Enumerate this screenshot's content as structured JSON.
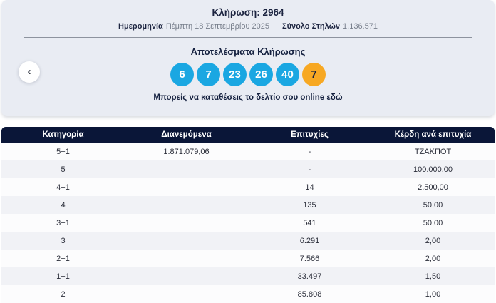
{
  "colors": {
    "navy": "#0a1638",
    "ball_blue": "#1aa7e2",
    "ball_orange": "#f7a823",
    "card_bg": "#e9ecf3",
    "row_alt_bg": "#f1f2f6"
  },
  "header": {
    "draw_label": "Κλήρωση: 2964",
    "date_label": "Ημερομηνία",
    "date_value": "Πέμπτη 18 Σεπτεμβρίου 2025",
    "columns_label": "Σύνολο Στηλών",
    "columns_value": "1.136.571"
  },
  "results": {
    "title": "Αποτελέσματα Κλήρωσης",
    "main_numbers": [
      "6",
      "7",
      "23",
      "26",
      "40"
    ],
    "bonus_number": "7",
    "cta_text": "Μπορείς να καταθέσεις το δελτίο σου online εδώ",
    "prev_arrow": "‹"
  },
  "table": {
    "headers": [
      "Κατηγορία",
      "Διανεμόμενα",
      "Επιτυχίες",
      "Κέρδη ανά επιτυχία"
    ],
    "rows": [
      [
        "5+1",
        "1.871.079,06",
        "-",
        "ΤΖΑΚΠΟΤ"
      ],
      [
        "5",
        "",
        "-",
        "100.000,00"
      ],
      [
        "4+1",
        "",
        "14",
        "2.500,00"
      ],
      [
        "4",
        "",
        "135",
        "50,00"
      ],
      [
        "3+1",
        "",
        "541",
        "50,00"
      ],
      [
        "3",
        "",
        "6.291",
        "2,00"
      ],
      [
        "2+1",
        "",
        "7.566",
        "2,00"
      ],
      [
        "1+1",
        "",
        "33.497",
        "1,50"
      ],
      [
        "2",
        "",
        "85.808",
        "1,00"
      ]
    ]
  }
}
